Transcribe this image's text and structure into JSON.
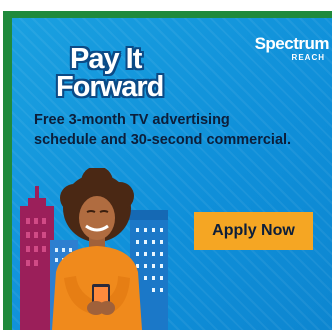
{
  "brand": {
    "name": "Spectrum",
    "sub": "REACH"
  },
  "logo": {
    "line1": "Pay It",
    "line2": "Forward"
  },
  "headline": {
    "line1": "Free 3-month TV advertising",
    "line2": "schedule and 30-second commercial."
  },
  "cta": {
    "label": "Apply Now"
  },
  "colors": {
    "background": "#1199dd",
    "frame": "#1f8a3c",
    "cta": "#f5a623",
    "text_dark": "#0c1e3a",
    "sweater": "#f08a1c",
    "building_pink": "#9b1f5a"
  }
}
